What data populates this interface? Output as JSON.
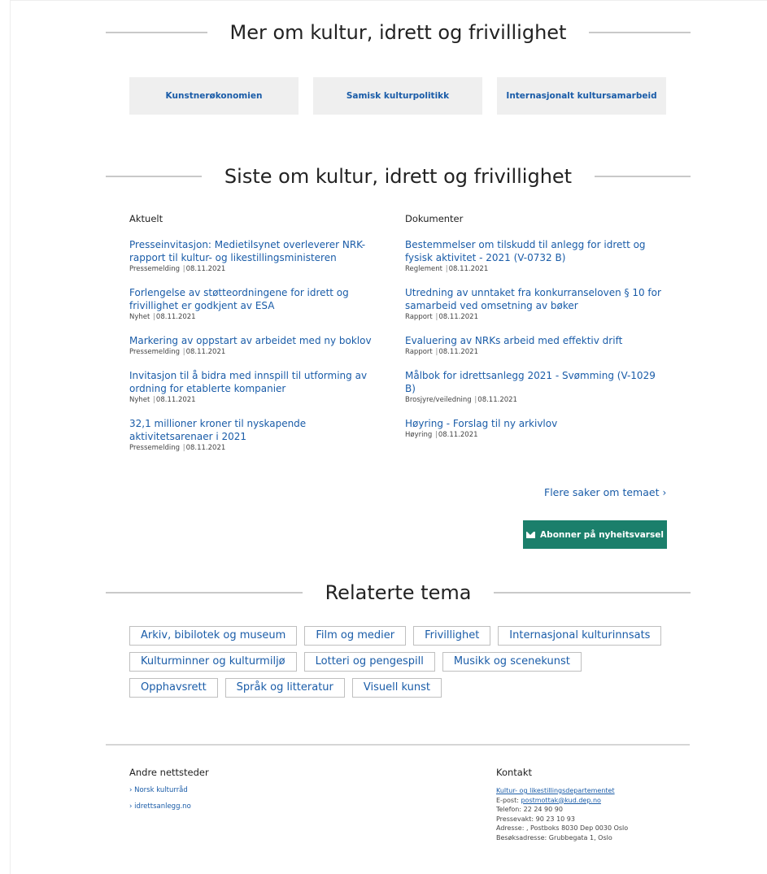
{
  "sections": {
    "more": {
      "title": "Mer om kultur, idrett og frivillighet"
    },
    "latest": {
      "title": "Siste om kultur, idrett og frivillighet"
    },
    "related": {
      "title": "Relaterte tema"
    }
  },
  "topic_cards": [
    "Kunstnerøkonomien",
    "Samisk kulturpolitikk",
    "Internasjonalt kultursamarbeid"
  ],
  "news": {
    "title": "Aktuelt",
    "items": [
      {
        "title": "Presseinvitasjon: Medietilsynet overleverer NRK-rapport til kultur- og likestillingsministeren",
        "type": "Pressemelding",
        "date": "08.11.2021"
      },
      {
        "title": "Forlengelse av støtteordningene for idrett og frivillighet er godkjent av ESA",
        "type": "Nyhet",
        "date": "08.11.2021"
      },
      {
        "title": "Markering av oppstart av arbeidet med ny boklov",
        "type": "Pressemelding",
        "date": "08.11.2021"
      },
      {
        "title": "Invitasjon til å bidra med innspill til utforming av ordning for etablerte kompanier",
        "type": "Nyhet",
        "date": "08.11.2021"
      },
      {
        "title": "32,1 millioner kroner til nyskapende aktivitetsarenaer i 2021",
        "type": "Pressemelding",
        "date": "08.11.2021"
      }
    ]
  },
  "documents": {
    "title": "Dokumenter",
    "items": [
      {
        "title": "Bestemmelser om tilskudd til anlegg for idrett og fysisk aktivitet - 2021 (V-0732 B)",
        "type": "Reglement",
        "date": "08.11.2021"
      },
      {
        "title": "Utredning av unntaket fra konkurranseloven § 10 for samarbeid ved omsetning av bøker",
        "type": "Rapport",
        "date": "08.11.2021"
      },
      {
        "title": "Evaluering av NRKs arbeid med effektiv drift",
        "type": "Rapport",
        "date": "08.11.2021"
      },
      {
        "title": "Målbok for idrettsanlegg 2021 - Svømming (V-1029 B)",
        "type": "Brosjyre/veiledning",
        "date": "08.11.2021"
      },
      {
        "title": "Høyring - Forslag til ny arkivlov",
        "type": "Høyring",
        "date": "08.11.2021"
      }
    ]
  },
  "more_link": "Flere saker om temaet",
  "subscribe": {
    "label": "Abonner på nyheitsvarsel",
    "color": "#1b7f6b"
  },
  "tags": [
    "Arkiv, bibilotek og museum",
    "Film og medier",
    "Frivillighet",
    "Internasjonal kulturinnsats",
    "Kulturminner og kulturmiljø",
    "Lotteri og pengespill",
    "Musikk og scenekunst",
    "Opphavsrett",
    "Språk og litteratur",
    "Visuell kunst"
  ],
  "footer": {
    "other_sites": {
      "title": "Andre nettsteder",
      "links": [
        "Norsk kulturråd",
        "idrettsanlegg.no"
      ]
    },
    "contact": {
      "title": "Kontakt",
      "org": "Kultur- og likestillingsdepartementet",
      "email_label": "E-post: ",
      "email": "postmottak@kud.dep.no",
      "phone": "Telefon: 22 24 90 90",
      "press": "Pressevakt: 90 23 10 93",
      "address": "Adresse: , Postboks 8030 Dep 0030 Oslo",
      "visit": "Besøksadresse: Grubbegata 1, Oslo"
    }
  },
  "colors": {
    "link": "#1a5ca8",
    "card_bg": "#efefef",
    "accent": "#1b7f6b"
  }
}
